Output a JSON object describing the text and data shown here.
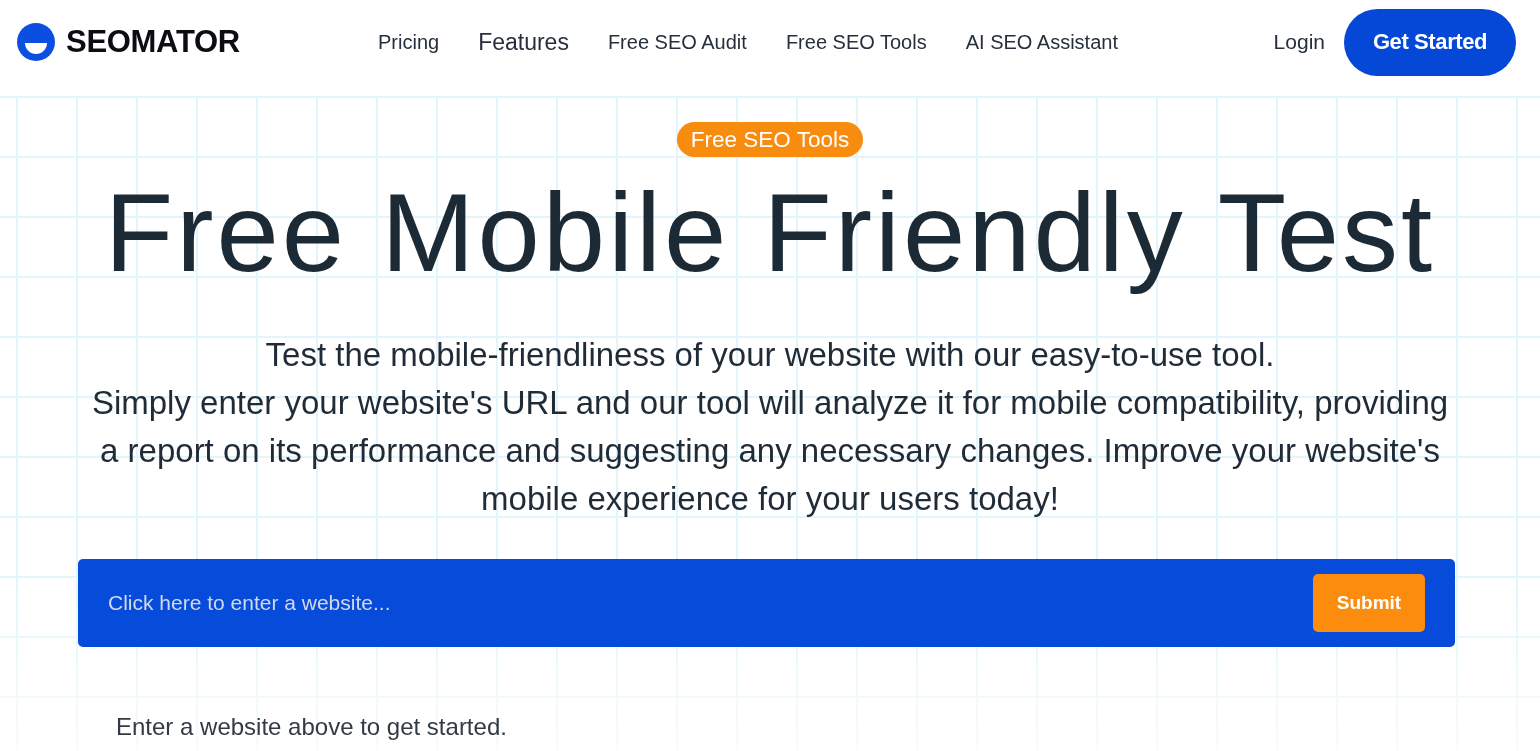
{
  "header": {
    "logo": {
      "text": "SEOMATOR"
    },
    "nav": [
      {
        "label": "Pricing",
        "kind": "link"
      },
      {
        "label": "Features",
        "kind": "menu"
      },
      {
        "label": "Free SEO Audit",
        "kind": "link"
      },
      {
        "label": "Free SEO Tools",
        "kind": "link"
      },
      {
        "label": "AI SEO Assistant",
        "kind": "link"
      }
    ],
    "login": "Login",
    "cta": "Get Started"
  },
  "hero": {
    "badge": "Free SEO Tools",
    "title": "Free Mobile Friendly Test",
    "intro": "Test the mobile-friendliness of your website with our easy-to-use tool.",
    "description": "Simply enter your website's URL and our tool will analyze it for mobile compatibility, providing a report on its performance and suggesting any necessary changes. Improve your website's mobile experience for your users today!",
    "form": {
      "placeholder": "Click here to enter a website...",
      "submit": "Submit"
    },
    "hint": "Enter a website above to get started."
  }
}
